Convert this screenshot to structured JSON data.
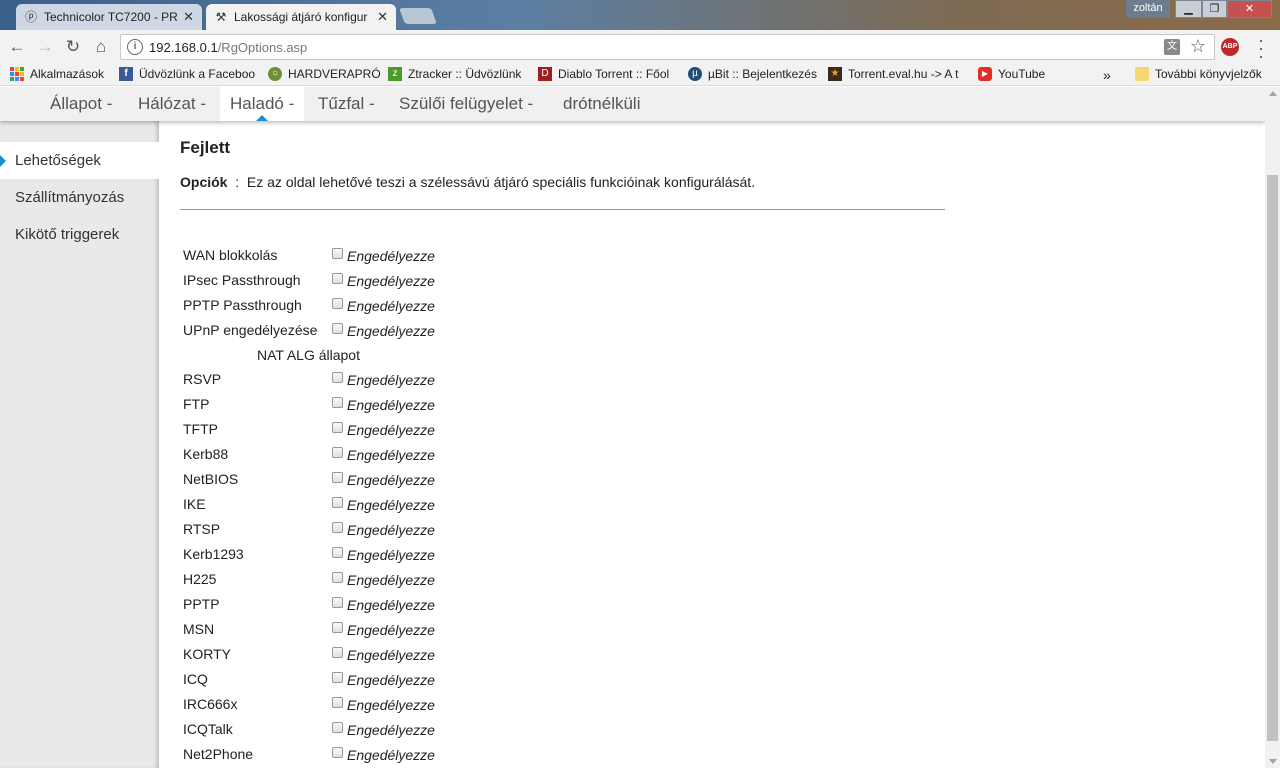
{
  "browser": {
    "tabs": [
      {
        "title": "Technicolor TC7200 - PR",
        "icon": "lollipop-favicon-icon",
        "active": false
      },
      {
        "title": "Lakossági átjáró konfigur",
        "icon": "tools-hammer-icon",
        "active": true
      }
    ],
    "user_name": "zoltán",
    "url_host": "192.168.0.1",
    "url_path": "/RgOptions.asp",
    "extension_label": "ABP",
    "bookmarks": [
      {
        "label": "Alkalmazások",
        "icon": "apps-grid-icon"
      },
      {
        "label": "Üdvözlünk a Faceboo",
        "icon": "facebook-icon",
        "color": "#3b5998"
      },
      {
        "label": "HARDVERAPRÓ",
        "icon": "hardverapro-icon",
        "color": "#6e8f3a"
      },
      {
        "label": "Ztracker :: Üdvözlünk",
        "icon": "ztracker-icon",
        "color": "#4a9a2e"
      },
      {
        "label": "Diablo Torrent :: Főol",
        "icon": "diablo-icon",
        "color": "#9b2020"
      },
      {
        "label": "µBit :: Bejelentkezés",
        "icon": "ubit-icon",
        "color": "#1f4e79"
      },
      {
        "label": "Torrent.eval.hu -> A t",
        "icon": "star-icon",
        "color": "#3a2a1a"
      },
      {
        "label": "YouTube",
        "icon": "youtube-icon",
        "color": "#e52d27"
      }
    ],
    "overflow_label": "»",
    "other_bookmarks": "További könyvjelzők"
  },
  "nav": {
    "items": [
      "Állapot -",
      "Hálózat -",
      "Haladó -",
      "Tűzfal -",
      "Szülői felügyelet -",
      "drótnélküli"
    ],
    "active_index": 2
  },
  "sidebar": {
    "items": [
      "Lehetőségek",
      "Szállítmányozás",
      "Kikötő triggerek"
    ],
    "active_index": 0
  },
  "main": {
    "title": "Fejlett",
    "options_label": "Opciók",
    "options_separator": ":",
    "options_desc": "Ez az oldal lehetővé teszi a szélessávú átjáró speciális funkcióinak konfigurálását.",
    "enable_label": "Engedélyezze",
    "general_options": [
      {
        "label": "WAN blokkolás",
        "checked": false
      },
      {
        "label": "IPsec Passthrough",
        "checked": false
      },
      {
        "label": "PPTP Passthrough",
        "checked": false
      },
      {
        "label": "UPnP engedélyezése",
        "checked": false
      }
    ],
    "nat_header": "NAT ALG állapot",
    "nat_options": [
      {
        "label": "RSVP",
        "checked": false
      },
      {
        "label": "FTP",
        "checked": false
      },
      {
        "label": "TFTP",
        "checked": false
      },
      {
        "label": "Kerb88",
        "checked": false
      },
      {
        "label": "NetBIOS",
        "checked": false
      },
      {
        "label": "IKE",
        "checked": false
      },
      {
        "label": "RTSP",
        "checked": false
      },
      {
        "label": "Kerb1293",
        "checked": false
      },
      {
        "label": "H225",
        "checked": false
      },
      {
        "label": "PPTP",
        "checked": false
      },
      {
        "label": "MSN",
        "checked": false
      },
      {
        "label": "KORTY",
        "checked": false
      },
      {
        "label": "ICQ",
        "checked": false
      },
      {
        "label": "IRC666x",
        "checked": false
      },
      {
        "label": "ICQTalk",
        "checked": false
      },
      {
        "label": "Net2Phone",
        "checked": false
      }
    ]
  },
  "colors": {
    "accent": "#1a8fd8"
  }
}
